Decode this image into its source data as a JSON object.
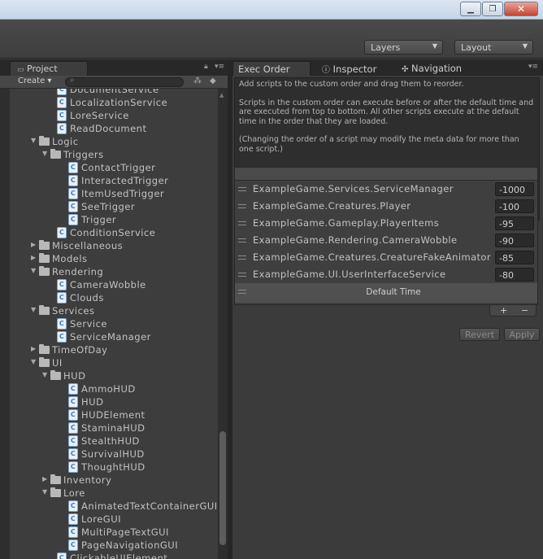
{
  "toolbar": {
    "layers_label": "Layers",
    "layout_label": "Layout"
  },
  "project": {
    "tab_label": "Project",
    "create_label": "Create",
    "tree": [
      {
        "label": "DocumentService",
        "kind": "script",
        "depth": 2
      },
      {
        "label": "LocalizationService",
        "kind": "script",
        "depth": 2
      },
      {
        "label": "LoreService",
        "kind": "script",
        "depth": 2
      },
      {
        "label": "ReadDocument",
        "kind": "script",
        "depth": 2
      },
      {
        "label": "Logic",
        "kind": "folder-open",
        "depth": 1
      },
      {
        "label": "Triggers",
        "kind": "folder-open",
        "depth": 2
      },
      {
        "label": "ContactTrigger",
        "kind": "script",
        "depth": 3
      },
      {
        "label": "InteractedTrigger",
        "kind": "script",
        "depth": 3
      },
      {
        "label": "ItemUsedTrigger",
        "kind": "script",
        "depth": 3
      },
      {
        "label": "SeeTrigger",
        "kind": "script",
        "depth": 3
      },
      {
        "label": "Trigger",
        "kind": "script",
        "depth": 3
      },
      {
        "label": "ConditionService",
        "kind": "script",
        "depth": 2
      },
      {
        "label": "Miscellaneous",
        "kind": "folder",
        "depth": 1
      },
      {
        "label": "Models",
        "kind": "folder",
        "depth": 1
      },
      {
        "label": "Rendering",
        "kind": "folder-open",
        "depth": 1
      },
      {
        "label": "CameraWobble",
        "kind": "script",
        "depth": 2
      },
      {
        "label": "Clouds",
        "kind": "script",
        "depth": 2
      },
      {
        "label": "Services",
        "kind": "folder-open",
        "depth": 1
      },
      {
        "label": "Service",
        "kind": "script",
        "depth": 2
      },
      {
        "label": "ServiceManager",
        "kind": "script",
        "depth": 2
      },
      {
        "label": "TimeOfDay",
        "kind": "folder",
        "depth": 1
      },
      {
        "label": "UI",
        "kind": "folder-open",
        "depth": 1
      },
      {
        "label": "HUD",
        "kind": "folder-open",
        "depth": 2
      },
      {
        "label": "AmmoHUD",
        "kind": "script",
        "depth": 3
      },
      {
        "label": "HUD",
        "kind": "script",
        "depth": 3
      },
      {
        "label": "HUDElement",
        "kind": "script",
        "depth": 3
      },
      {
        "label": "StaminaHUD",
        "kind": "script",
        "depth": 3
      },
      {
        "label": "StealthHUD",
        "kind": "script",
        "depth": 3
      },
      {
        "label": "SurvivalHUD",
        "kind": "script",
        "depth": 3
      },
      {
        "label": "ThoughtHUD",
        "kind": "script",
        "depth": 3
      },
      {
        "label": "Inventory",
        "kind": "folder",
        "depth": 2
      },
      {
        "label": "Lore",
        "kind": "folder-open",
        "depth": 2
      },
      {
        "label": "AnimatedTextContainerGUI",
        "kind": "script",
        "depth": 3
      },
      {
        "label": "LoreGUI",
        "kind": "script",
        "depth": 3
      },
      {
        "label": "MultiPageTextGUI",
        "kind": "script",
        "depth": 3
      },
      {
        "label": "PageNavigationGUI",
        "kind": "script",
        "depth": 3
      },
      {
        "label": "ClickableUIElement",
        "kind": "script",
        "depth": 2
      }
    ]
  },
  "tabs": {
    "exec_order": "Exec Order",
    "inspector": "Inspector",
    "navigation": "Navigation"
  },
  "help": {
    "line1": "Add scripts to the custom order and drag them to reorder.",
    "line2": "Scripts in the custom order can execute before or after the default time and are executed from top to bottom. All other scripts execute at the default time in the order that they are loaded.",
    "line3": "(Changing the order of a script may modify the meta data for more than one script.)"
  },
  "exec_order": {
    "items": [
      {
        "name": "ExampleGame.Services.ServiceManager",
        "value": "-1000"
      },
      {
        "name": "ExampleGame.Creatures.Player",
        "value": "-100"
      },
      {
        "name": "ExampleGame.Gameplay.PlayerItems",
        "value": "-95"
      },
      {
        "name": "ExampleGame.Rendering.CameraWobble",
        "value": "-90"
      },
      {
        "name": "ExampleGame.Creatures.CreatureFakeAnimator",
        "value": "-85"
      },
      {
        "name": "ExampleGame.UI.UserInterfaceService",
        "value": "-80"
      }
    ],
    "default_time_label": "Default Time",
    "plus": "+",
    "minus": "−",
    "revert_label": "Revert",
    "apply_label": "Apply"
  }
}
